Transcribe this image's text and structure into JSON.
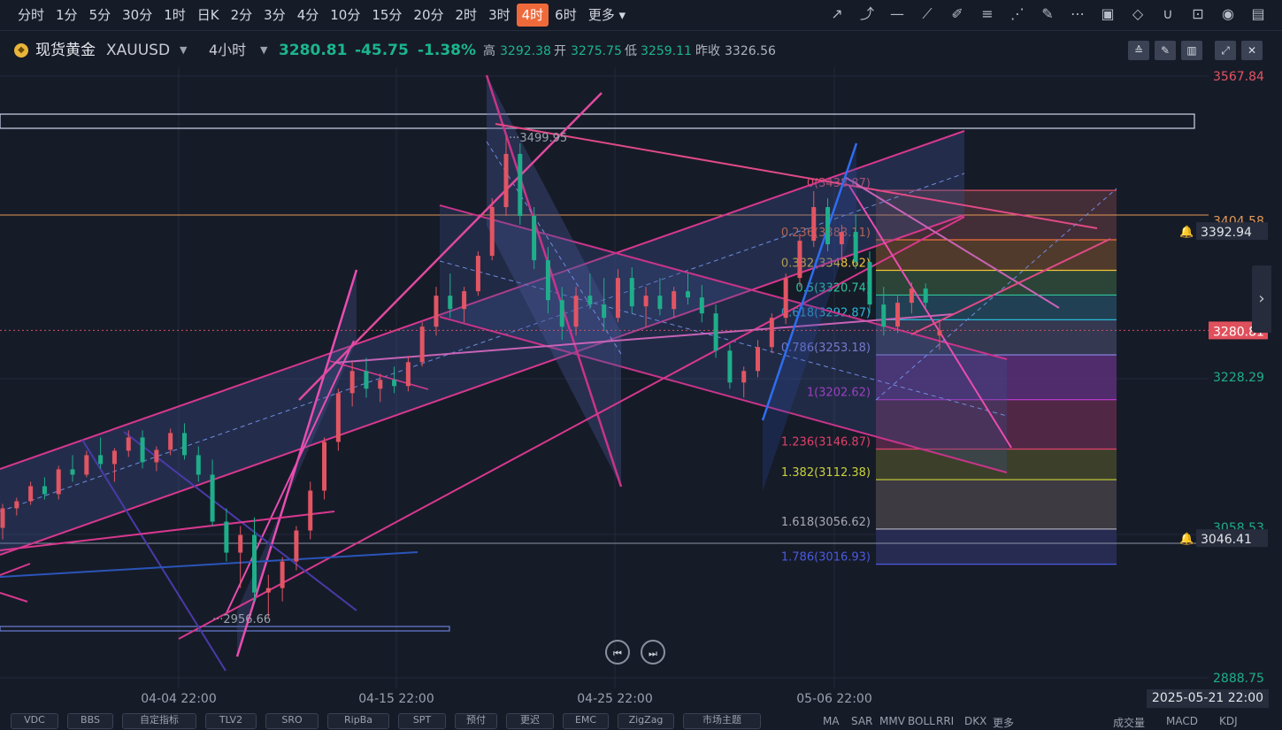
{
  "toolbar": {
    "timeframes": [
      "分时",
      "1分",
      "5分",
      "30分",
      "1时",
      "日K",
      "2分",
      "3分",
      "4分",
      "10分",
      "15分",
      "20分",
      "2时",
      "3时",
      "4时",
      "6时",
      "更多"
    ],
    "active_timeframe": "4时",
    "tools": [
      "trendline-icon",
      "ray-icon",
      "horizontal-line-icon",
      "segment-icon",
      "brush-icon",
      "fibonacci-icon",
      "fan-icon",
      "highlighter-icon",
      "more-icon",
      "edit-icon",
      "eraser-icon",
      "magnet-icon",
      "lock-icon",
      "eye-icon",
      "trash-icon"
    ]
  },
  "header": {
    "symbol": "现货黄金",
    "code": "XAUUSD",
    "interval": "4小时",
    "price": "3280.81",
    "change": "-45.75",
    "change_pct": "-1.38%",
    "high_label": "高",
    "high": "3292.38",
    "open_label": "开",
    "open": "3275.75",
    "low_label": "低",
    "low": "3259.11",
    "prev_label": "昨收",
    "prev": "3326.56"
  },
  "chart_data": {
    "type": "candlestick",
    "ylim": [
      2870,
      3585
    ],
    "y_tick_labels": [
      "3567.84",
      "3404.58",
      "3228.29",
      "3058.53",
      "2888.75"
    ],
    "x_tick_labels": [
      "04-04 22:00",
      "04-15 22:00",
      "04-25 22:00",
      "05-06 22:00"
    ],
    "current_price": 3280.81,
    "price_tags": [
      {
        "label": "3392.94",
        "value": 3392.94,
        "kind": "alert"
      },
      {
        "label": "3280.81",
        "value": 3280.81,
        "kind": "current"
      },
      {
        "label": "3046.41",
        "value": 3046.41,
        "kind": "alert"
      }
    ],
    "annotations": [
      {
        "label": "3499.95",
        "value": 3499.95
      },
      {
        "label": "2956.66",
        "value": 2956.66
      }
    ],
    "fibonacci": [
      {
        "label": "0(3438.87)",
        "value": 3438.87,
        "color": "#e0506a",
        "fill": "#4b3038"
      },
      {
        "label": "0.236(3383.11)",
        "value": 3383.11,
        "color": "#f0703a",
        "fill": "#5a3f2c"
      },
      {
        "label": "0.382(3348.62)",
        "value": 3348.62,
        "color": "#f2c43a",
        "fill": "#2f4b3a"
      },
      {
        "label": "0.5(3320.74)",
        "value": 3320.74,
        "color": "#2ec49a",
        "fill": "#23465a"
      },
      {
        "label": "0.618(3292.87)",
        "value": 3292.87,
        "color": "#2ab7d9",
        "fill": "#3a3d58"
      },
      {
        "label": "0.786(3253.18)",
        "value": 3253.18,
        "color": "#8c8ae8",
        "fill": "#5a2f78"
      },
      {
        "label": "1(3202.62)",
        "value": 3202.62,
        "color": "#c53ad6",
        "fill": "#5b2a4a"
      },
      {
        "label": "1.236(3146.87)",
        "value": 3146.87,
        "color": "#e0406a",
        "fill": "#43462a"
      },
      {
        "label": "1.382(3112.38)",
        "value": 3112.38,
        "color": "#c8d23a",
        "fill": "#444046"
      },
      {
        "label": "1.618(3056.62)",
        "value": 3056.62,
        "color": "#a8a8b4",
        "fill": "#2a2e58"
      },
      {
        "label": "1.786(3016.93)",
        "value": 3016.93,
        "color": "#4a5ae0",
        "fill": "none"
      }
    ],
    "series": [
      {
        "x": 0,
        "o": 3058,
        "h": 3085,
        "l": 3045,
        "c": 3080
      },
      {
        "x": 1,
        "o": 3080,
        "h": 3092,
        "l": 3072,
        "c": 3088
      },
      {
        "x": 2,
        "o": 3088,
        "h": 3110,
        "l": 3084,
        "c": 3105
      },
      {
        "x": 3,
        "o": 3105,
        "h": 3115,
        "l": 3090,
        "c": 3096
      },
      {
        "x": 4,
        "o": 3096,
        "h": 3128,
        "l": 3090,
        "c": 3124
      },
      {
        "x": 5,
        "o": 3124,
        "h": 3140,
        "l": 3110,
        "c": 3118
      },
      {
        "x": 6,
        "o": 3118,
        "h": 3145,
        "l": 3115,
        "c": 3140
      },
      {
        "x": 7,
        "o": 3140,
        "h": 3160,
        "l": 3125,
        "c": 3130
      },
      {
        "x": 8,
        "o": 3130,
        "h": 3148,
        "l": 3110,
        "c": 3145
      },
      {
        "x": 9,
        "o": 3145,
        "h": 3168,
        "l": 3138,
        "c": 3160
      },
      {
        "x": 10,
        "o": 3160,
        "h": 3168,
        "l": 3125,
        "c": 3132
      },
      {
        "x": 11,
        "o": 3132,
        "h": 3150,
        "l": 3122,
        "c": 3146
      },
      {
        "x": 12,
        "o": 3146,
        "h": 3170,
        "l": 3140,
        "c": 3165
      },
      {
        "x": 13,
        "o": 3165,
        "h": 3176,
        "l": 3135,
        "c": 3140
      },
      {
        "x": 14,
        "o": 3140,
        "h": 3150,
        "l": 3110,
        "c": 3118
      },
      {
        "x": 15,
        "o": 3118,
        "h": 3135,
        "l": 3060,
        "c": 3065
      },
      {
        "x": 16,
        "o": 3065,
        "h": 3080,
        "l": 3020,
        "c": 3030
      },
      {
        "x": 17,
        "o": 3030,
        "h": 3060,
        "l": 2990,
        "c": 3050
      },
      {
        "x": 18,
        "o": 3050,
        "h": 3070,
        "l": 2975,
        "c": 2985
      },
      {
        "x": 19,
        "o": 2985,
        "h": 3005,
        "l": 2957,
        "c": 2990
      },
      {
        "x": 20,
        "o": 2990,
        "h": 3025,
        "l": 2975,
        "c": 3020
      },
      {
        "x": 21,
        "o": 3020,
        "h": 3060,
        "l": 3010,
        "c": 3055
      },
      {
        "x": 22,
        "o": 3055,
        "h": 3110,
        "l": 3045,
        "c": 3100
      },
      {
        "x": 23,
        "o": 3100,
        "h": 3160,
        "l": 3090,
        "c": 3155
      },
      {
        "x": 24,
        "o": 3155,
        "h": 3215,
        "l": 3145,
        "c": 3210
      },
      {
        "x": 25,
        "o": 3210,
        "h": 3245,
        "l": 3195,
        "c": 3235
      },
      {
        "x": 26,
        "o": 3235,
        "h": 3250,
        "l": 3205,
        "c": 3215
      },
      {
        "x": 27,
        "o": 3215,
        "h": 3232,
        "l": 3200,
        "c": 3225
      },
      {
        "x": 28,
        "o": 3225,
        "h": 3240,
        "l": 3210,
        "c": 3218
      },
      {
        "x": 29,
        "o": 3218,
        "h": 3252,
        "l": 3212,
        "c": 3245
      },
      {
        "x": 30,
        "o": 3245,
        "h": 3290,
        "l": 3240,
        "c": 3285
      },
      {
        "x": 31,
        "o": 3285,
        "h": 3330,
        "l": 3275,
        "c": 3320
      },
      {
        "x": 32,
        "o": 3320,
        "h": 3345,
        "l": 3295,
        "c": 3305
      },
      {
        "x": 33,
        "o": 3305,
        "h": 3330,
        "l": 3290,
        "c": 3325
      },
      {
        "x": 34,
        "o": 3325,
        "h": 3370,
        "l": 3320,
        "c": 3365
      },
      {
        "x": 35,
        "o": 3365,
        "h": 3430,
        "l": 3360,
        "c": 3420
      },
      {
        "x": 36,
        "o": 3420,
        "h": 3500,
        "l": 3410,
        "c": 3480
      },
      {
        "x": 37,
        "o": 3480,
        "h": 3492,
        "l": 3400,
        "c": 3410
      },
      {
        "x": 38,
        "o": 3410,
        "h": 3420,
        "l": 3350,
        "c": 3360
      },
      {
        "x": 39,
        "o": 3360,
        "h": 3375,
        "l": 3300,
        "c": 3315
      },
      {
        "x": 40,
        "o": 3315,
        "h": 3330,
        "l": 3270,
        "c": 3285
      },
      {
        "x": 41,
        "o": 3285,
        "h": 3330,
        "l": 3275,
        "c": 3320
      },
      {
        "x": 42,
        "o": 3320,
        "h": 3345,
        "l": 3305,
        "c": 3310
      },
      {
        "x": 43,
        "o": 3310,
        "h": 3340,
        "l": 3280,
        "c": 3295
      },
      {
        "x": 44,
        "o": 3295,
        "h": 3350,
        "l": 3290,
        "c": 3340
      },
      {
        "x": 45,
        "o": 3340,
        "h": 3352,
        "l": 3300,
        "c": 3308
      },
      {
        "x": 46,
        "o": 3308,
        "h": 3330,
        "l": 3285,
        "c": 3320
      },
      {
        "x": 47,
        "o": 3320,
        "h": 3340,
        "l": 3298,
        "c": 3305
      },
      {
        "x": 48,
        "o": 3305,
        "h": 3330,
        "l": 3295,
        "c": 3325
      },
      {
        "x": 49,
        "o": 3325,
        "h": 3345,
        "l": 3310,
        "c": 3318
      },
      {
        "x": 50,
        "o": 3318,
        "h": 3332,
        "l": 3290,
        "c": 3300
      },
      {
        "x": 51,
        "o": 3300,
        "h": 3310,
        "l": 3250,
        "c": 3258
      },
      {
        "x": 52,
        "o": 3258,
        "h": 3265,
        "l": 3215,
        "c": 3222
      },
      {
        "x": 53,
        "o": 3222,
        "h": 3240,
        "l": 3205,
        "c": 3235
      },
      {
        "x": 54,
        "o": 3235,
        "h": 3270,
        "l": 3228,
        "c": 3262
      },
      {
        "x": 55,
        "o": 3262,
        "h": 3300,
        "l": 3255,
        "c": 3295
      },
      {
        "x": 56,
        "o": 3295,
        "h": 3345,
        "l": 3288,
        "c": 3340
      },
      {
        "x": 57,
        "o": 3340,
        "h": 3390,
        "l": 3330,
        "c": 3382
      },
      {
        "x": 58,
        "o": 3382,
        "h": 3438,
        "l": 3375,
        "c": 3420
      },
      {
        "x": 59,
        "o": 3420,
        "h": 3430,
        "l": 3370,
        "c": 3378
      },
      {
        "x": 60,
        "o": 3378,
        "h": 3400,
        "l": 3360,
        "c": 3392
      },
      {
        "x": 61,
        "o": 3392,
        "h": 3412,
        "l": 3350,
        "c": 3358
      },
      {
        "x": 62,
        "o": 3358,
        "h": 3370,
        "l": 3300,
        "c": 3310
      },
      {
        "x": 63,
        "o": 3310,
        "h": 3330,
        "l": 3275,
        "c": 3285
      },
      {
        "x": 64,
        "o": 3285,
        "h": 3320,
        "l": 3278,
        "c": 3312
      },
      {
        "x": 65,
        "o": 3312,
        "h": 3335,
        "l": 3300,
        "c": 3328
      },
      {
        "x": 66,
        "o": 3328,
        "h": 3334,
        "l": 3305,
        "c": 3312
      },
      {
        "x": 67,
        "o": 3275,
        "h": 3292,
        "l": 3259,
        "c": 3281
      }
    ]
  },
  "bottom_tabs": [
    "VDC",
    "BBS",
    "自定指标",
    "TLV2",
    "SRO",
    "RipBa",
    "SPT",
    "预付",
    "更迟",
    "EMC",
    "ZigZag",
    "市场主题"
  ],
  "bottom_indicators": [
    "MA",
    "SAR",
    "MMV",
    "BOLL",
    "RRI",
    "DKX",
    "更多"
  ],
  "bottom_right": [
    "成交量",
    "MACD",
    "KDJ"
  ],
  "date_tag": "2025-05-21 22:00"
}
